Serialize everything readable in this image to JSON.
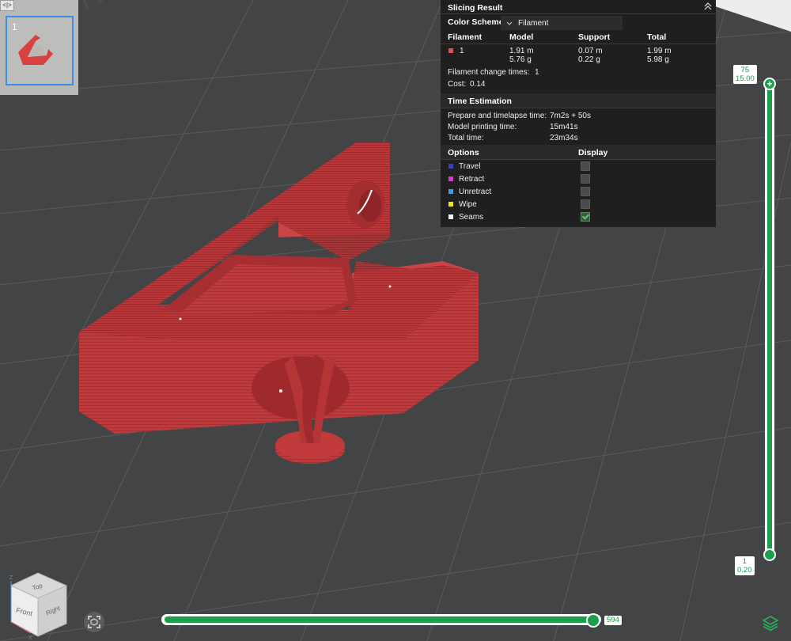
{
  "thumbnail": {
    "toggle_label": "<|>",
    "plate_number": "1"
  },
  "slicing_result": {
    "title": "Slicing Result",
    "color_scheme_label": "Color Scheme",
    "color_scheme_value": "Filament",
    "columns": [
      "Filament",
      "Model",
      "Support",
      "Total"
    ],
    "filament_row": {
      "id": "1",
      "color": "#e05050",
      "model_length": "1.91 m",
      "model_weight": "5.76 g",
      "support_length": "0.07 m",
      "support_weight": "0.22 g",
      "total_length": "1.99 m",
      "total_weight": "5.98 g"
    },
    "filament_change_label": "Filament change times:",
    "filament_change_value": "1",
    "cost_label": "Cost:",
    "cost_value": "0.14"
  },
  "time_estimation": {
    "title": "Time Estimation",
    "rows": [
      {
        "label": "Prepare and timelapse time:",
        "value": "7m2s + 50s"
      },
      {
        "label": "Model printing time:",
        "value": "15m41s"
      },
      {
        "label": "Total time:",
        "value": "23m34s"
      }
    ]
  },
  "options": {
    "header_left": "Options",
    "header_right": "Display",
    "items": [
      {
        "label": "Travel",
        "color": "#3b3ec9",
        "checked": false
      },
      {
        "label": "Retract",
        "color": "#d33ad4",
        "checked": false
      },
      {
        "label": "Unretract",
        "color": "#3f9fcf",
        "checked": false
      },
      {
        "label": "Wipe",
        "color": "#f0e31c",
        "checked": false
      },
      {
        "label": "Seams",
        "color": "#f0f0f0",
        "checked": true
      }
    ]
  },
  "layer_slider": {
    "top_layer": "75",
    "top_height": "15.00",
    "bottom_layer": "1",
    "bottom_height": "0.20"
  },
  "move_slider": {
    "value": "594"
  },
  "view_cube": {
    "top": "Top",
    "front": "Front",
    "right": "Right",
    "axis_x": "X",
    "axis_z": "Z"
  },
  "colors": {
    "accent": "#1aa04a",
    "model": "#c0393b"
  }
}
